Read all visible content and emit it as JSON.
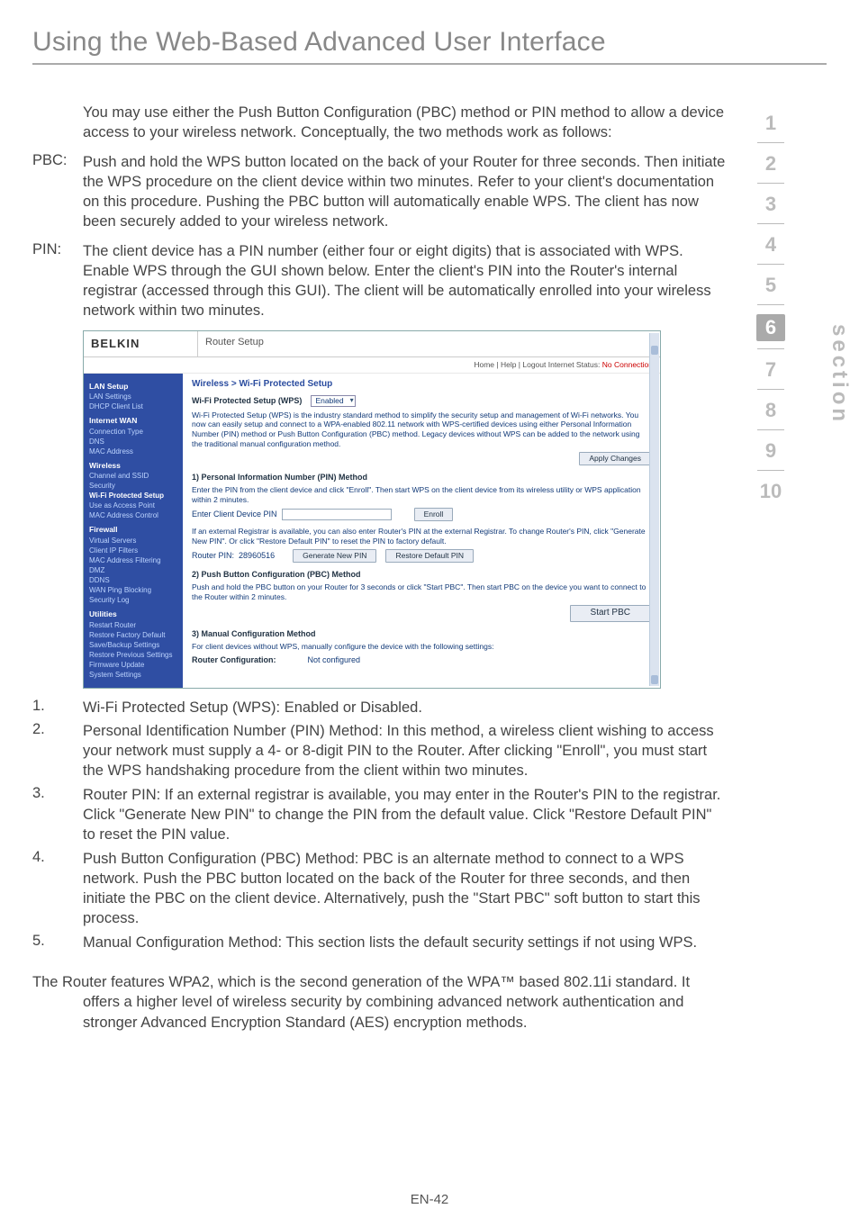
{
  "page": {
    "title": "Using the Web-Based Advanced User Interface",
    "footer": "EN-42"
  },
  "intro": "You may use either the Push Button Configuration (PBC) method or PIN method to allow a device access to your wireless network. Conceptually, the two methods work as follows:",
  "pbc": {
    "label": "PBC:",
    "text": "Push and hold the WPS button located on the back of your Router for three seconds. Then initiate the WPS procedure on the client device within two minutes. Refer to your client's documentation on this procedure. Pushing the PBC button will automatically enable WPS. The client has now been securely added to your wireless network."
  },
  "pin": {
    "label": "PIN:",
    "text": "The client device has a PIN number (either four or eight digits) that is associated with WPS. Enable WPS through the GUI shown below. Enter the client's PIN into the Router's internal registrar (accessed through this GUI). The client will be automatically enrolled into your wireless network within two minutes."
  },
  "list": [
    {
      "n": "1.",
      "t": "Wi-Fi Protected Setup (WPS): Enabled or Disabled."
    },
    {
      "n": "2.",
      "t": "Personal Identification Number (PIN) Method: In this method, a wireless client wishing to access your network must supply a 4- or 8-digit PIN to the Router. After clicking \"Enroll\", you must start the WPS handshaking procedure from the client within two minutes."
    },
    {
      "n": "3.",
      "t": "Router PIN: If an external registrar is available, you may enter in the Router's PIN to the registrar. Click \"Generate New PIN\" to change the PIN from the default value. Click \"Restore Default PIN\" to reset the PIN value."
    },
    {
      "n": "4.",
      "t": "Push Button Configuration (PBC) Method: PBC is an alternate method to connect to a WPS network. Push the PBC button located on the back of the Router for three seconds, and then initiate the PBC on the client device. Alternatively, push the \"Start PBC\" soft button to start this process."
    },
    {
      "n": "5.",
      "t": "Manual Configuration Method: This section lists the default security settings if not using WPS."
    }
  ],
  "closing": "The Router features WPA2, which is the second generation of the WPA™ based 802.11i standard. It offers a higher level of wireless security by combining advanced network authentication and stronger Advanced Encryption Standard (AES) encryption methods.",
  "section_nav": {
    "items": [
      "1",
      "2",
      "3",
      "4",
      "5",
      "6",
      "7",
      "8",
      "9",
      "10"
    ],
    "active_index": 5,
    "word": "section"
  },
  "shot": {
    "logo": "BELKIN",
    "title": "Router Setup",
    "topbar_left": "Home | Help | Logout   Internet Status:",
    "topbar_status": "No Connection",
    "crumb": "Wireless > Wi-Fi Protected Setup",
    "nav": {
      "groups": [
        {
          "h": "LAN Setup",
          "items": [
            "LAN Settings",
            "DHCP Client List"
          ]
        },
        {
          "h": "Internet WAN",
          "items": [
            "Connection Type",
            "DNS",
            "MAC Address"
          ]
        },
        {
          "h": "Wireless",
          "items": [
            "Channel and SSID",
            "Security",
            "Wi-Fi Protected Setup",
            "Use as Access Point",
            "MAC Address Control"
          ]
        },
        {
          "h": "Firewall",
          "items": [
            "Virtual Servers",
            "Client IP Filters",
            "MAC Address Filtering",
            "DMZ",
            "DDNS",
            "WAN Ping Blocking",
            "Security Log"
          ]
        },
        {
          "h": "Utilities",
          "items": [
            "Restart Router",
            "Restore Factory Default",
            "Save/Backup Settings",
            "Restore Previous Settings",
            "Firmware Update",
            "System Settings"
          ]
        }
      ]
    },
    "wps_label": "Wi-Fi Protected Setup (WPS)",
    "wps_value": "Enabled",
    "wps_desc": "Wi-Fi Protected Setup (WPS) is the industry standard method to simplify the security setup and management of Wi-Fi networks. You now can easily setup and connect to a WPA-enabled 802.11 network with WPS-certified devices using either Personal Information Number (PIN) method or Push Button Configuration (PBC) method. Legacy devices without WPS can be added to the network using the traditional manual configuration method.",
    "apply": "Apply Changes",
    "s1": "1) Personal Information Number (PIN) Method",
    "s1_desc": "Enter the PIN from the client device and click \"Enroll\". Then start WPS on the client device from its wireless utility or WPS application within 2 minutes.",
    "s1_input": "Enter Client Device PIN",
    "enroll": "Enroll",
    "s1_reg": "If an external Registrar is available, you can also enter Router's PIN at the external Registrar. To change Router's PIN, click \"Generate New PIN\". Or click \"Restore Default PIN\" to reset the PIN to factory default.",
    "router_pin_label": "Router PIN:",
    "router_pin_value": "28960516",
    "gen_btn": "Generate New PIN",
    "restore_btn": "Restore Default PIN",
    "s2": "2) Push Button Configuration (PBC) Method",
    "s2_desc": "Push and hold the PBC button on your Router for 3 seconds or click \"Start PBC\". Then start PBC on the device you want to connect to the Router within 2 minutes.",
    "start_pbc": "Start PBC",
    "s3": "3) Manual Configuration Method",
    "s3_desc": "For client devices without WPS, manually configure the device with the following settings:",
    "rc_label": "Router Configuration:",
    "rc_value": "Not configured"
  }
}
